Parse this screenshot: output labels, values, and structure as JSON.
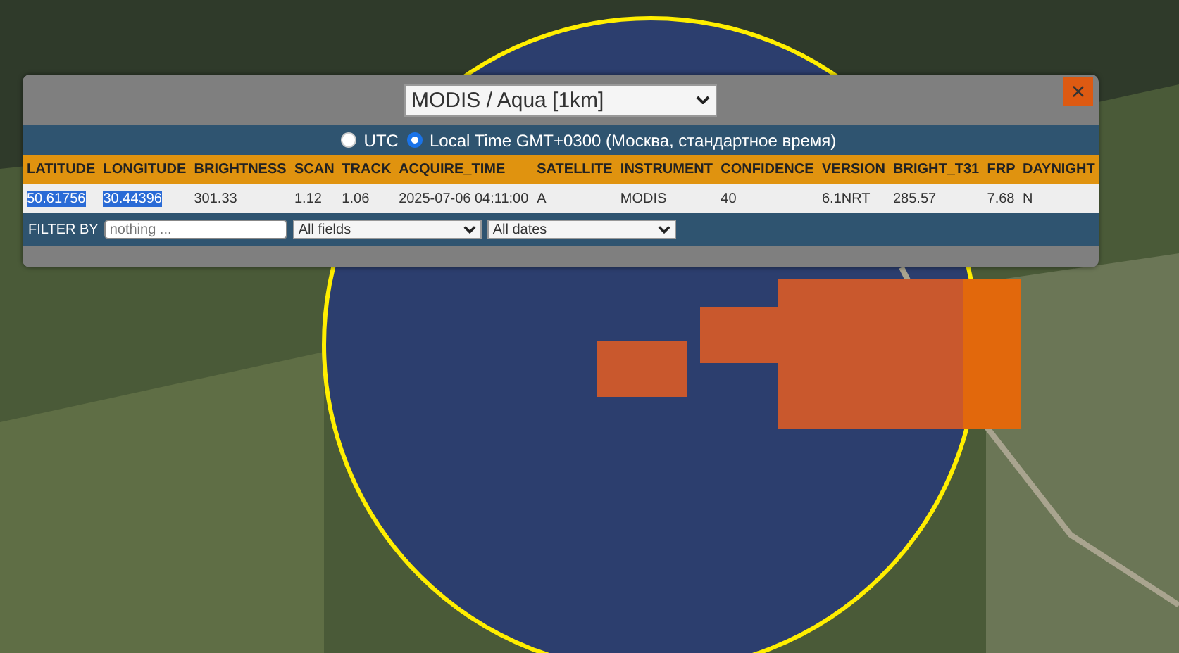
{
  "source_select": {
    "value": "MODIS / Aqua [1km]"
  },
  "close_button": {
    "label": "×"
  },
  "time_mode": [
    {
      "label": "UTC",
      "selected": false
    },
    {
      "label": "Local Time GMT+0300 (Москва, стандартное время)",
      "selected": true
    }
  ],
  "table": {
    "columns": [
      "LATITUDE",
      "LONGITUDE",
      "BRIGHTNESS",
      "SCAN",
      "TRACK",
      "ACQUIRE_TIME",
      "SATELLITE",
      "INSTRUMENT",
      "CONFIDENCE",
      "VERSION",
      "BRIGHT_T31",
      "FRP",
      "DAYNIGHT"
    ],
    "rows": [
      [
        {
          "text": "50.61756",
          "highlighted": true
        },
        {
          "text": "30.44396",
          "highlighted": true
        },
        {
          "text": "301.33",
          "highlighted": false
        },
        {
          "text": "1.12",
          "highlighted": false
        },
        {
          "text": "1.06",
          "highlighted": false
        },
        {
          "text": "2025-07-06 04:11:00",
          "highlighted": false
        },
        {
          "text": "A",
          "highlighted": false
        },
        {
          "text": "MODIS",
          "highlighted": false
        },
        {
          "text": "40",
          "highlighted": false
        },
        {
          "text": "6.1NRT",
          "highlighted": false
        },
        {
          "text": "285.57",
          "highlighted": false
        },
        {
          "text": "7.68",
          "highlighted": false
        },
        {
          "text": "N",
          "highlighted": false
        }
      ]
    ]
  },
  "filter": {
    "label": "FILTER BY",
    "placeholder": "nothing ...",
    "field_select": "All fields",
    "date_select": "All dates"
  }
}
